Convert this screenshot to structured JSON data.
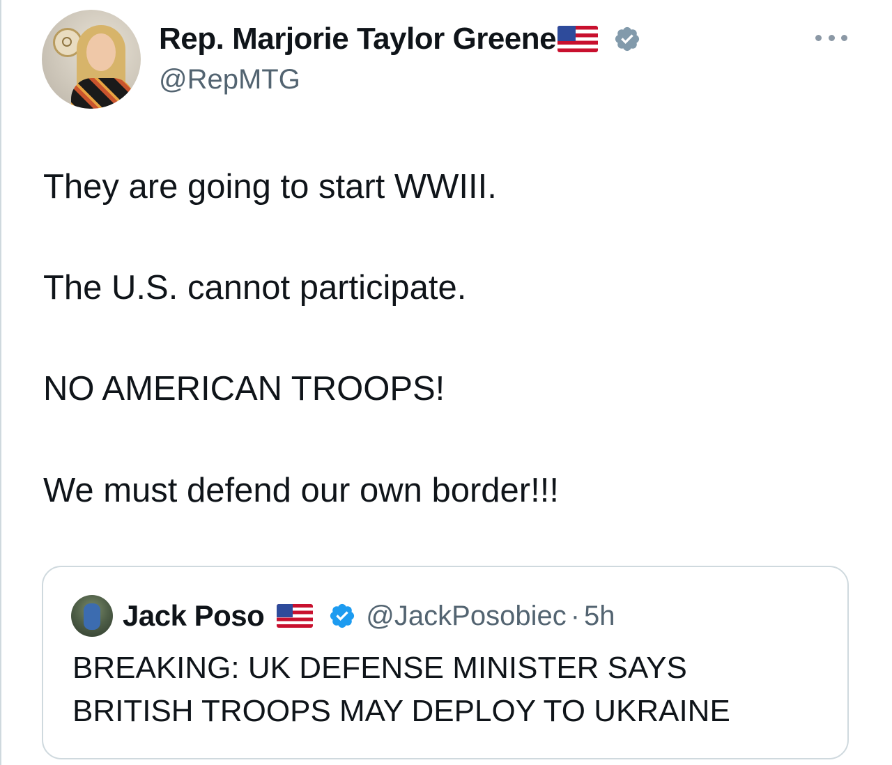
{
  "tweet": {
    "author_name": "Rep. Marjorie Taylor Greene",
    "author_handle": "@RepMTG",
    "flag_icon": "us-flag-icon",
    "verified_icon": "verified-badge-icon",
    "verified_color": "#829aab",
    "more_icon": "more-options-icon",
    "lines": [
      "They are going to start WWIII.",
      "The U.S. cannot participate.",
      "NO AMERICAN TROOPS!",
      "We must defend our own border!!!"
    ]
  },
  "quoted_tweet": {
    "author_name": "Jack Poso",
    "author_handle": "@JackPosobiec",
    "separator": "·",
    "time": "5h",
    "verified_color": "#1d9bf0",
    "lines": [
      "BREAKING: UK DEFENSE MINISTER SAYS",
      "BRITISH TROOPS MAY DEPLOY TO UKRAINE"
    ]
  }
}
